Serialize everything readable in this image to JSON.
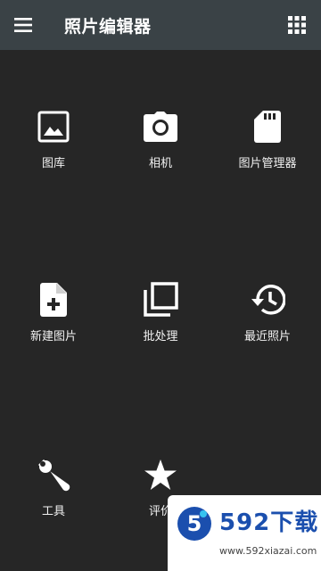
{
  "appbar": {
    "title": "照片编辑器",
    "menu_icon": "hamburger-menu-icon",
    "grid_icon": "apps-grid-icon",
    "background": "#3a4246"
  },
  "tiles": [
    {
      "label": "图库",
      "icon": "image-icon"
    },
    {
      "label": "相机",
      "icon": "camera-icon"
    },
    {
      "label": "图片管理器",
      "icon": "sd-card-icon"
    },
    {
      "label": "新建图片",
      "icon": "new-file-icon"
    },
    {
      "label": "批处理",
      "icon": "batch-layers-icon"
    },
    {
      "label": "最近照片",
      "icon": "history-icon"
    },
    {
      "label": "工具",
      "icon": "wrench-icon"
    },
    {
      "label": "评价",
      "icon": "star-icon"
    }
  ],
  "watermark": {
    "brand": "592下载",
    "url": "www.592xiazai.com",
    "badge_text": "5"
  },
  "colors": {
    "background": "#262626",
    "icon": "#ffffff",
    "text": "#f2f2f2"
  }
}
